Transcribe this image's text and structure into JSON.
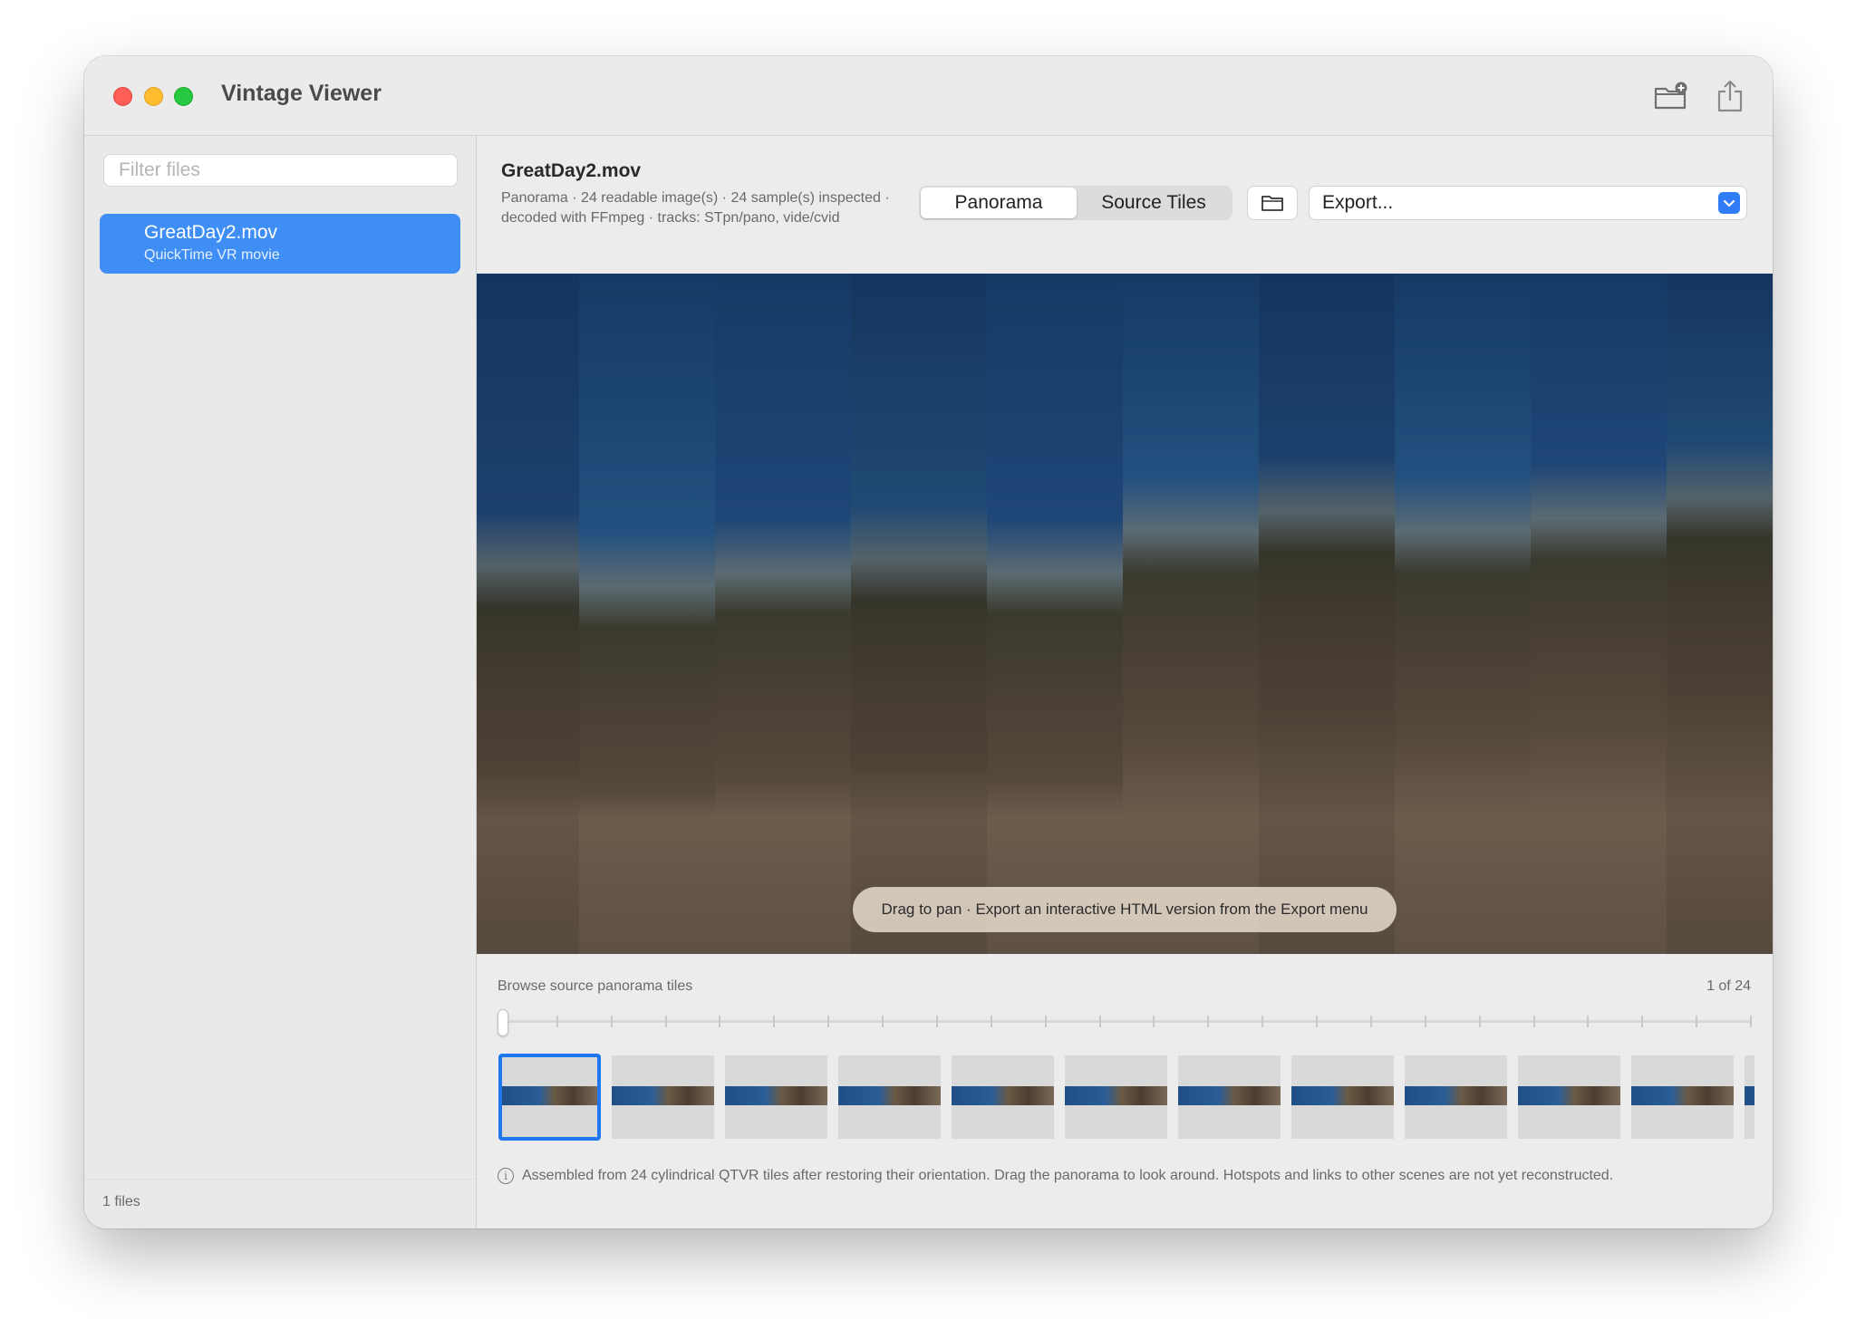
{
  "window": {
    "title": "Vintage Viewer"
  },
  "toolbar": {
    "add_folder_icon": "folder-badge-plus-icon",
    "share_icon": "share-icon"
  },
  "sidebar": {
    "filter_placeholder": "Filter files",
    "files": [
      {
        "name": "GreatDay2.mov",
        "kind": "QuickTime VR movie",
        "selected": true
      }
    ],
    "footer": "1 files"
  },
  "header": {
    "title": "GreatDay2.mov",
    "meta": "Panorama · 24 readable image(s) · 24 sample(s) inspected · decoded with FFmpeg · tracks: STpn/pano, vide/cvid",
    "segments": [
      {
        "label": "Panorama",
        "active": true
      },
      {
        "label": "Source Tiles",
        "active": false
      }
    ],
    "folder_icon": "folder-icon",
    "export_value": "Export..."
  },
  "panorama": {
    "hint": "Drag to pan · Export an interactive HTML version from the Export menu"
  },
  "tiles": {
    "label": "Browse source panorama tiles",
    "count": "1 of 24",
    "current": 1,
    "total": 24,
    "visible_thumbnails": 12
  },
  "info": {
    "text": "Assembled from 24 cylindrical QTVR tiles after restoring their orientation. Drag the panorama to look around. Hotspots and links to other scenes are not yet reconstructed."
  },
  "colors": {
    "accent": "#3f8ef5",
    "selection_border": "#1f78f0"
  }
}
